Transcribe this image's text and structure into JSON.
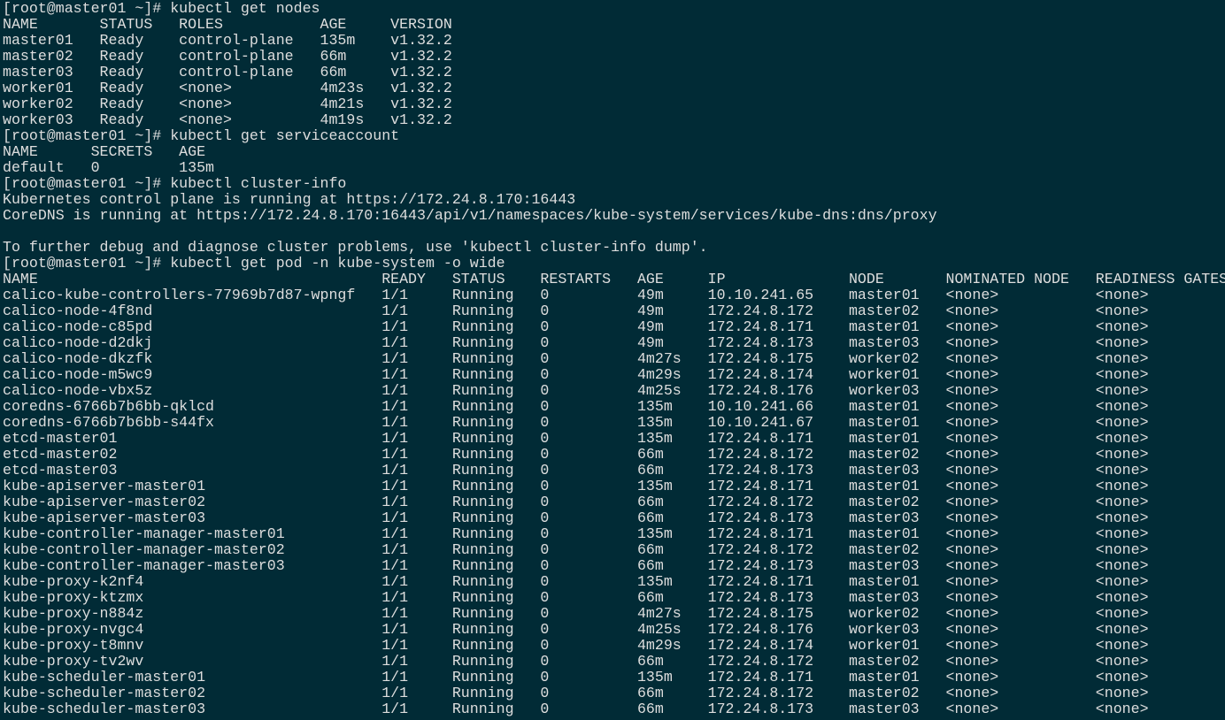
{
  "terminal": {
    "background_color": "#012b36",
    "text_color": "#dedede",
    "lines": [
      "[root@master01 ~]# kubectl get nodes",
      "NAME       STATUS   ROLES           AGE     VERSION",
      "master01   Ready    control-plane   135m    v1.32.2",
      "master02   Ready    control-plane   66m     v1.32.2",
      "master03   Ready    control-plane   66m     v1.32.2",
      "worker01   Ready    <none>          4m23s   v1.32.2",
      "worker02   Ready    <none>          4m21s   v1.32.2",
      "worker03   Ready    <none>          4m19s   v1.32.2",
      "[root@master01 ~]# kubectl get serviceaccount",
      "NAME      SECRETS   AGE",
      "default   0         135m",
      "[root@master01 ~]# kubectl cluster-info",
      "Kubernetes control plane is running at https://172.24.8.170:16443",
      "CoreDNS is running at https://172.24.8.170:16443/api/v1/namespaces/kube-system/services/kube-dns:dns/proxy",
      "",
      "To further debug and diagnose cluster problems, use 'kubectl cluster-info dump'.",
      "[root@master01 ~]# kubectl get pod -n kube-system -o wide",
      "NAME                                       READY   STATUS    RESTARTS   AGE     IP              NODE       NOMINATED NODE   READINESS GATES",
      "calico-kube-controllers-77969b7d87-wpngf   1/1     Running   0          49m     10.10.241.65    master01   <none>           <none>",
      "calico-node-4f8nd                          1/1     Running   0          49m     172.24.8.172    master02   <none>           <none>",
      "calico-node-c85pd                          1/1     Running   0          49m     172.24.8.171    master01   <none>           <none>",
      "calico-node-d2dkj                          1/1     Running   0          49m     172.24.8.173    master03   <none>           <none>",
      "calico-node-dkzfk                          1/1     Running   0          4m27s   172.24.8.175    worker02   <none>           <none>",
      "calico-node-m5wc9                          1/1     Running   0          4m29s   172.24.8.174    worker01   <none>           <none>",
      "calico-node-vbx5z                          1/1     Running   0          4m25s   172.24.8.176    worker03   <none>           <none>",
      "coredns-6766b7b6bb-qklcd                   1/1     Running   0          135m    10.10.241.66    master01   <none>           <none>",
      "coredns-6766b7b6bb-s44fx                   1/1     Running   0          135m    10.10.241.67    master01   <none>           <none>",
      "etcd-master01                              1/1     Running   0          135m    172.24.8.171    master01   <none>           <none>",
      "etcd-master02                              1/1     Running   0          66m     172.24.8.172    master02   <none>           <none>",
      "etcd-master03                              1/1     Running   0          66m     172.24.8.173    master03   <none>           <none>",
      "kube-apiserver-master01                    1/1     Running   0          135m    172.24.8.171    master01   <none>           <none>",
      "kube-apiserver-master02                    1/1     Running   0          66m     172.24.8.172    master02   <none>           <none>",
      "kube-apiserver-master03                    1/1     Running   0          66m     172.24.8.173    master03   <none>           <none>",
      "kube-controller-manager-master01           1/1     Running   0          135m    172.24.8.171    master01   <none>           <none>",
      "kube-controller-manager-master02           1/1     Running   0          66m     172.24.8.172    master02   <none>           <none>",
      "kube-controller-manager-master03           1/1     Running   0          66m     172.24.8.173    master03   <none>           <none>",
      "kube-proxy-k2nf4                           1/1     Running   0          135m    172.24.8.171    master01   <none>           <none>",
      "kube-proxy-ktzmx                           1/1     Running   0          66m     172.24.8.173    master03   <none>           <none>",
      "kube-proxy-n884z                           1/1     Running   0          4m27s   172.24.8.175    worker02   <none>           <none>",
      "kube-proxy-nvgc4                           1/1     Running   0          4m25s   172.24.8.176    worker03   <none>           <none>",
      "kube-proxy-t8mnv                           1/1     Running   0          4m29s   172.24.8.174    worker01   <none>           <none>",
      "kube-proxy-tv2wv                           1/1     Running   0          66m     172.24.8.172    master02   <none>           <none>",
      "kube-scheduler-master01                    1/1     Running   0          135m    172.24.8.171    master01   <none>           <none>",
      "kube-scheduler-master02                    1/1     Running   0          66m     172.24.8.172    master02   <none>           <none>",
      "kube-scheduler-master03                    1/1     Running   0          66m     172.24.8.173    master03   <none>           <none>"
    ]
  }
}
